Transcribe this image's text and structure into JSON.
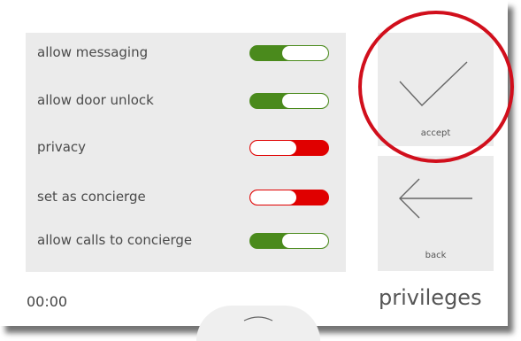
{
  "settings": {
    "items": [
      {
        "label": "allow messaging",
        "state": "on"
      },
      {
        "label": "allow door unlock",
        "state": "on"
      },
      {
        "label": "privacy",
        "state": "off"
      },
      {
        "label": "set as concierge",
        "state": "off"
      },
      {
        "label": "allow calls to concierge",
        "state": "on"
      }
    ]
  },
  "actions": {
    "accept_label": "accept",
    "back_label": "back"
  },
  "footer": {
    "time": "00:00",
    "page_title": "privileges"
  },
  "colors": {
    "toggle_on": "#4a8a1c",
    "toggle_off": "#e00000",
    "highlight_ring": "#d10f1c"
  },
  "icons": {
    "accept": "checkmark-icon",
    "back": "arrow-left-icon",
    "pull_tab": "chevron-up-icon"
  }
}
